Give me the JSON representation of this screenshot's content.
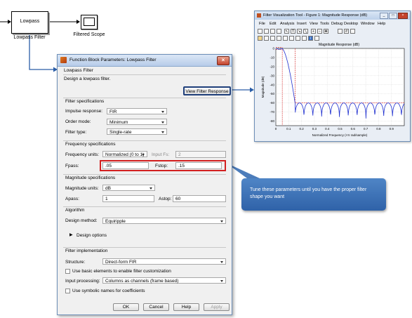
{
  "model": {
    "lowpass_block": "Lowpass",
    "lowpass_caption": "Lowpass Filter",
    "scope_caption": "Filtered Scope"
  },
  "dialog": {
    "title": "Function Block Parameters: Lowpass Filter",
    "header": "Lowpass Filter",
    "description": "Design a lowpass filter.",
    "view_response_button": "View Filter Response",
    "filter_specs": {
      "section": "Filter specifications",
      "impulse_label": "Impulse response:",
      "impulse_value": "FIR",
      "order_label": "Order mode:",
      "order_value": "Minimum",
      "type_label": "Filter type:",
      "type_value": "Single-rate"
    },
    "freq_specs": {
      "section": "Frequency specifications",
      "units_label": "Frequency units:",
      "units_value": "Normalized (0 to 1)",
      "input_fs_label": "Input Fs:",
      "input_fs_value": "2",
      "fpass_label": "Fpass:",
      "fpass_value": ".05",
      "fstop_label": "Fstop:",
      "fstop_value": ".15"
    },
    "mag_specs": {
      "section": "Magnitude specifications",
      "units_label": "Magnitude units:",
      "units_value": "dB",
      "apass_label": "Apass:",
      "apass_value": "1",
      "astop_label": "Astop:",
      "astop_value": "60"
    },
    "algorithm": {
      "section": "Algorithm",
      "method_label": "Design method:",
      "method_value": "Equiripple",
      "design_options": "Design options"
    },
    "implementation": {
      "section": "Filter implementation",
      "structure_label": "Structure:",
      "structure_value": "Direct-form FIR",
      "basic_elements": "Use basic elements to enable filter customization",
      "input_proc_label": "Input processing:",
      "input_proc_value": "Columns as channels (frame based)",
      "symbolic": "Use symbolic names for coefficients"
    },
    "buttons": {
      "ok": "OK",
      "cancel": "Cancel",
      "help": "Help",
      "apply": "Apply"
    }
  },
  "figure": {
    "title": "Filter Visualization Tool - Figure 1: Magnitude Response (dB)",
    "menu": [
      "File",
      "Edit",
      "Analysis",
      "Insert",
      "View",
      "Tools",
      "Debug",
      "Desktop",
      "Window",
      "Help"
    ],
    "plot_title": "Magnitude Response (dB)",
    "ylabel": "Magnitude (dB)",
    "xlabel": "Normalized Frequency (×π rad/sample)",
    "x_ticks": [
      "0",
      "0.1",
      "0.2",
      "0.3",
      "0.4",
      "0.5",
      "0.6",
      "0.7",
      "0.8",
      "0.9"
    ],
    "y_ticks": [
      "0",
      "-10",
      "-20",
      "-30",
      "-40",
      "-50",
      "-60",
      "-70",
      "-80"
    ]
  },
  "callout": {
    "text": "Tune these parameters until you have the proper filter shape you want"
  },
  "colors": {
    "highlight": "#d21f1f",
    "callout": "#3a6fb4",
    "response": "#1f2fd0",
    "spec_line": "#d21f1f"
  }
}
